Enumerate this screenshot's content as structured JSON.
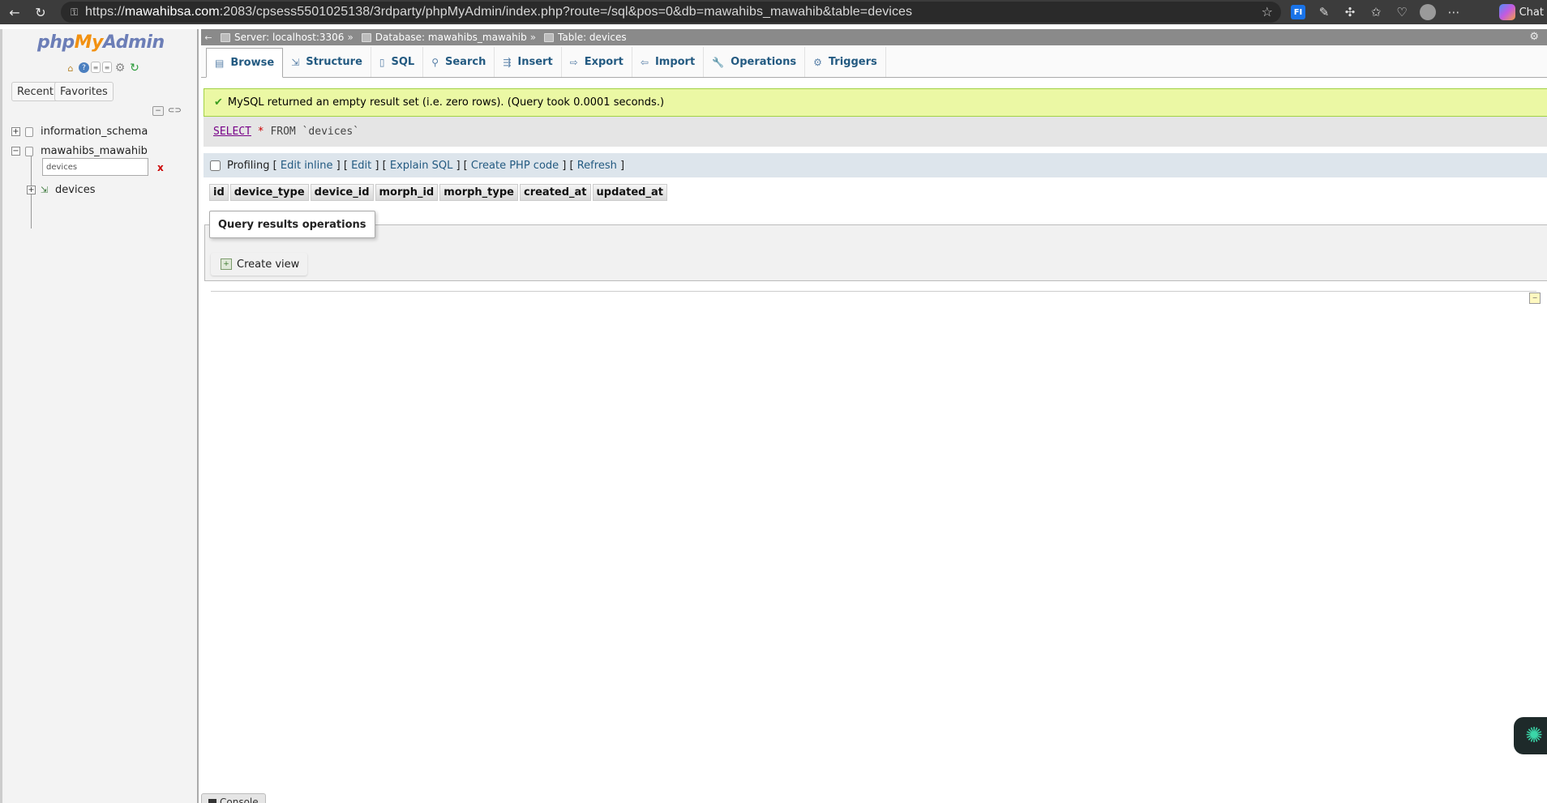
{
  "browser": {
    "url_prefix": "https://",
    "url_host": "mawahibsa.com",
    "url_rest": ":2083/cpsess5501025138/3rdparty/phpMyAdmin/index.php?route=/sql&pos=0&db=mawahibs_mawahib&table=devices",
    "ext_fi": "FI",
    "chat_label": "Chat"
  },
  "sidebar": {
    "logo_php": "php",
    "logo_my": "My",
    "logo_admin": "Admin",
    "recent_label": "Recent",
    "favorites_label": "Favorites",
    "databases": [
      {
        "name": "information_schema",
        "expander": "+"
      },
      {
        "name": "mawahibs_mawahib",
        "expander": "−"
      }
    ],
    "filter_value": "devices",
    "filter_clear": "x",
    "tables": [
      {
        "name": "devices",
        "expander": "+"
      }
    ]
  },
  "breadcrumb": {
    "server": "Server: localhost:3306",
    "database": "Database: mawahibs_mawahib",
    "table": "Table: devices",
    "sep": "»"
  },
  "tabs": [
    {
      "label": "Browse",
      "icon": "browse-icon",
      "glyph": "▤"
    },
    {
      "label": "Structure",
      "icon": "structure-icon",
      "glyph": "⇲"
    },
    {
      "label": "SQL",
      "icon": "sql-icon",
      "glyph": "▯"
    },
    {
      "label": "Search",
      "icon": "search-icon",
      "glyph": "⚲"
    },
    {
      "label": "Insert",
      "icon": "insert-icon",
      "glyph": "⇶"
    },
    {
      "label": "Export",
      "icon": "export-icon",
      "glyph": "⇨"
    },
    {
      "label": "Import",
      "icon": "import-icon",
      "glyph": "⇦"
    },
    {
      "label": "Operations",
      "icon": "wrench-icon",
      "glyph": "🔧"
    },
    {
      "label": "Triggers",
      "icon": "triggers-icon",
      "glyph": "⚙"
    }
  ],
  "message": {
    "text": "MySQL returned an empty result set (i.e. zero rows). (Query took 0.0001 seconds.)"
  },
  "sql": {
    "kw_select": "SELECT",
    "star": "*",
    "kw_from": "FROM",
    "table": "`devices`"
  },
  "profiling": {
    "label": "Profiling",
    "open": "[",
    "close": "]",
    "links": [
      "Edit inline",
      "Edit",
      "Explain SQL",
      "Create PHP code",
      "Refresh"
    ]
  },
  "columns": [
    "id",
    "device_type",
    "device_id",
    "morph_id",
    "morph_type",
    "created_at",
    "updated_at"
  ],
  "query_results_operations": {
    "legend": "Query results operations",
    "create_view_label": "Create view"
  },
  "console_label": "Console",
  "colors": {
    "success_bg": "#ebf8a4",
    "link": "#235a81",
    "breadcrumb_bg": "#8a8a8a"
  }
}
